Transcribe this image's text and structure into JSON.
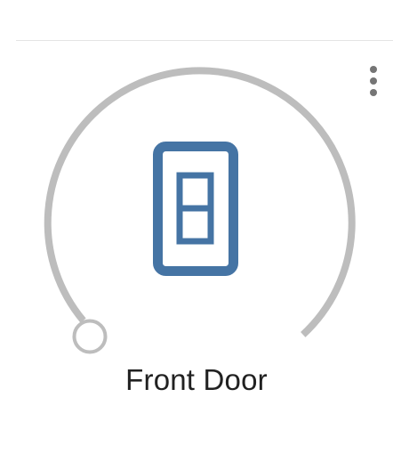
{
  "card": {
    "title": "Front Door"
  },
  "menu": {
    "icon": "more-vert-icon"
  },
  "lock": {
    "icon": "door-lock-icon",
    "color": "#4574a4"
  },
  "dial": {
    "track_color": "#bdbdbd",
    "thumb_color": "#bdbdbd",
    "thumb_fill": "#ffffff"
  }
}
